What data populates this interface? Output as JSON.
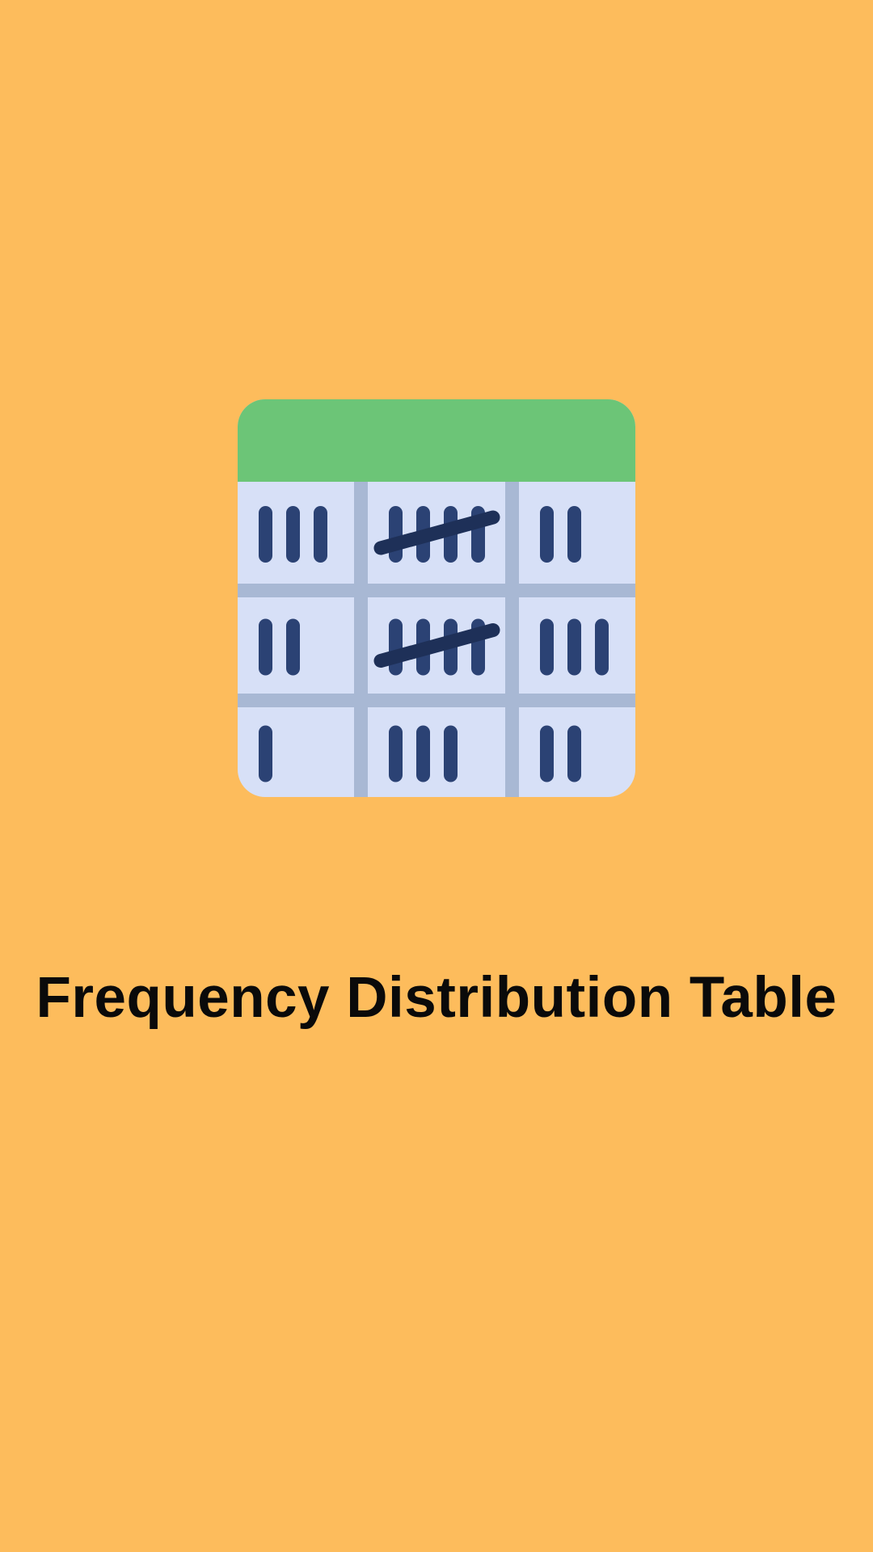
{
  "title": "Frequency Distribution Table",
  "icon": "tally-table-icon",
  "colors": {
    "background": "#FDBC5C",
    "header": "#6CC577",
    "cell": "#D7E0F7",
    "grid": "#A8B8D4",
    "tally": "#2B4274",
    "strike": "#1E3058",
    "title": "#0A0A0A"
  },
  "table": {
    "rows": [
      [
        3,
        5,
        2
      ],
      [
        2,
        5,
        3
      ],
      [
        1,
        3,
        2
      ]
    ]
  }
}
